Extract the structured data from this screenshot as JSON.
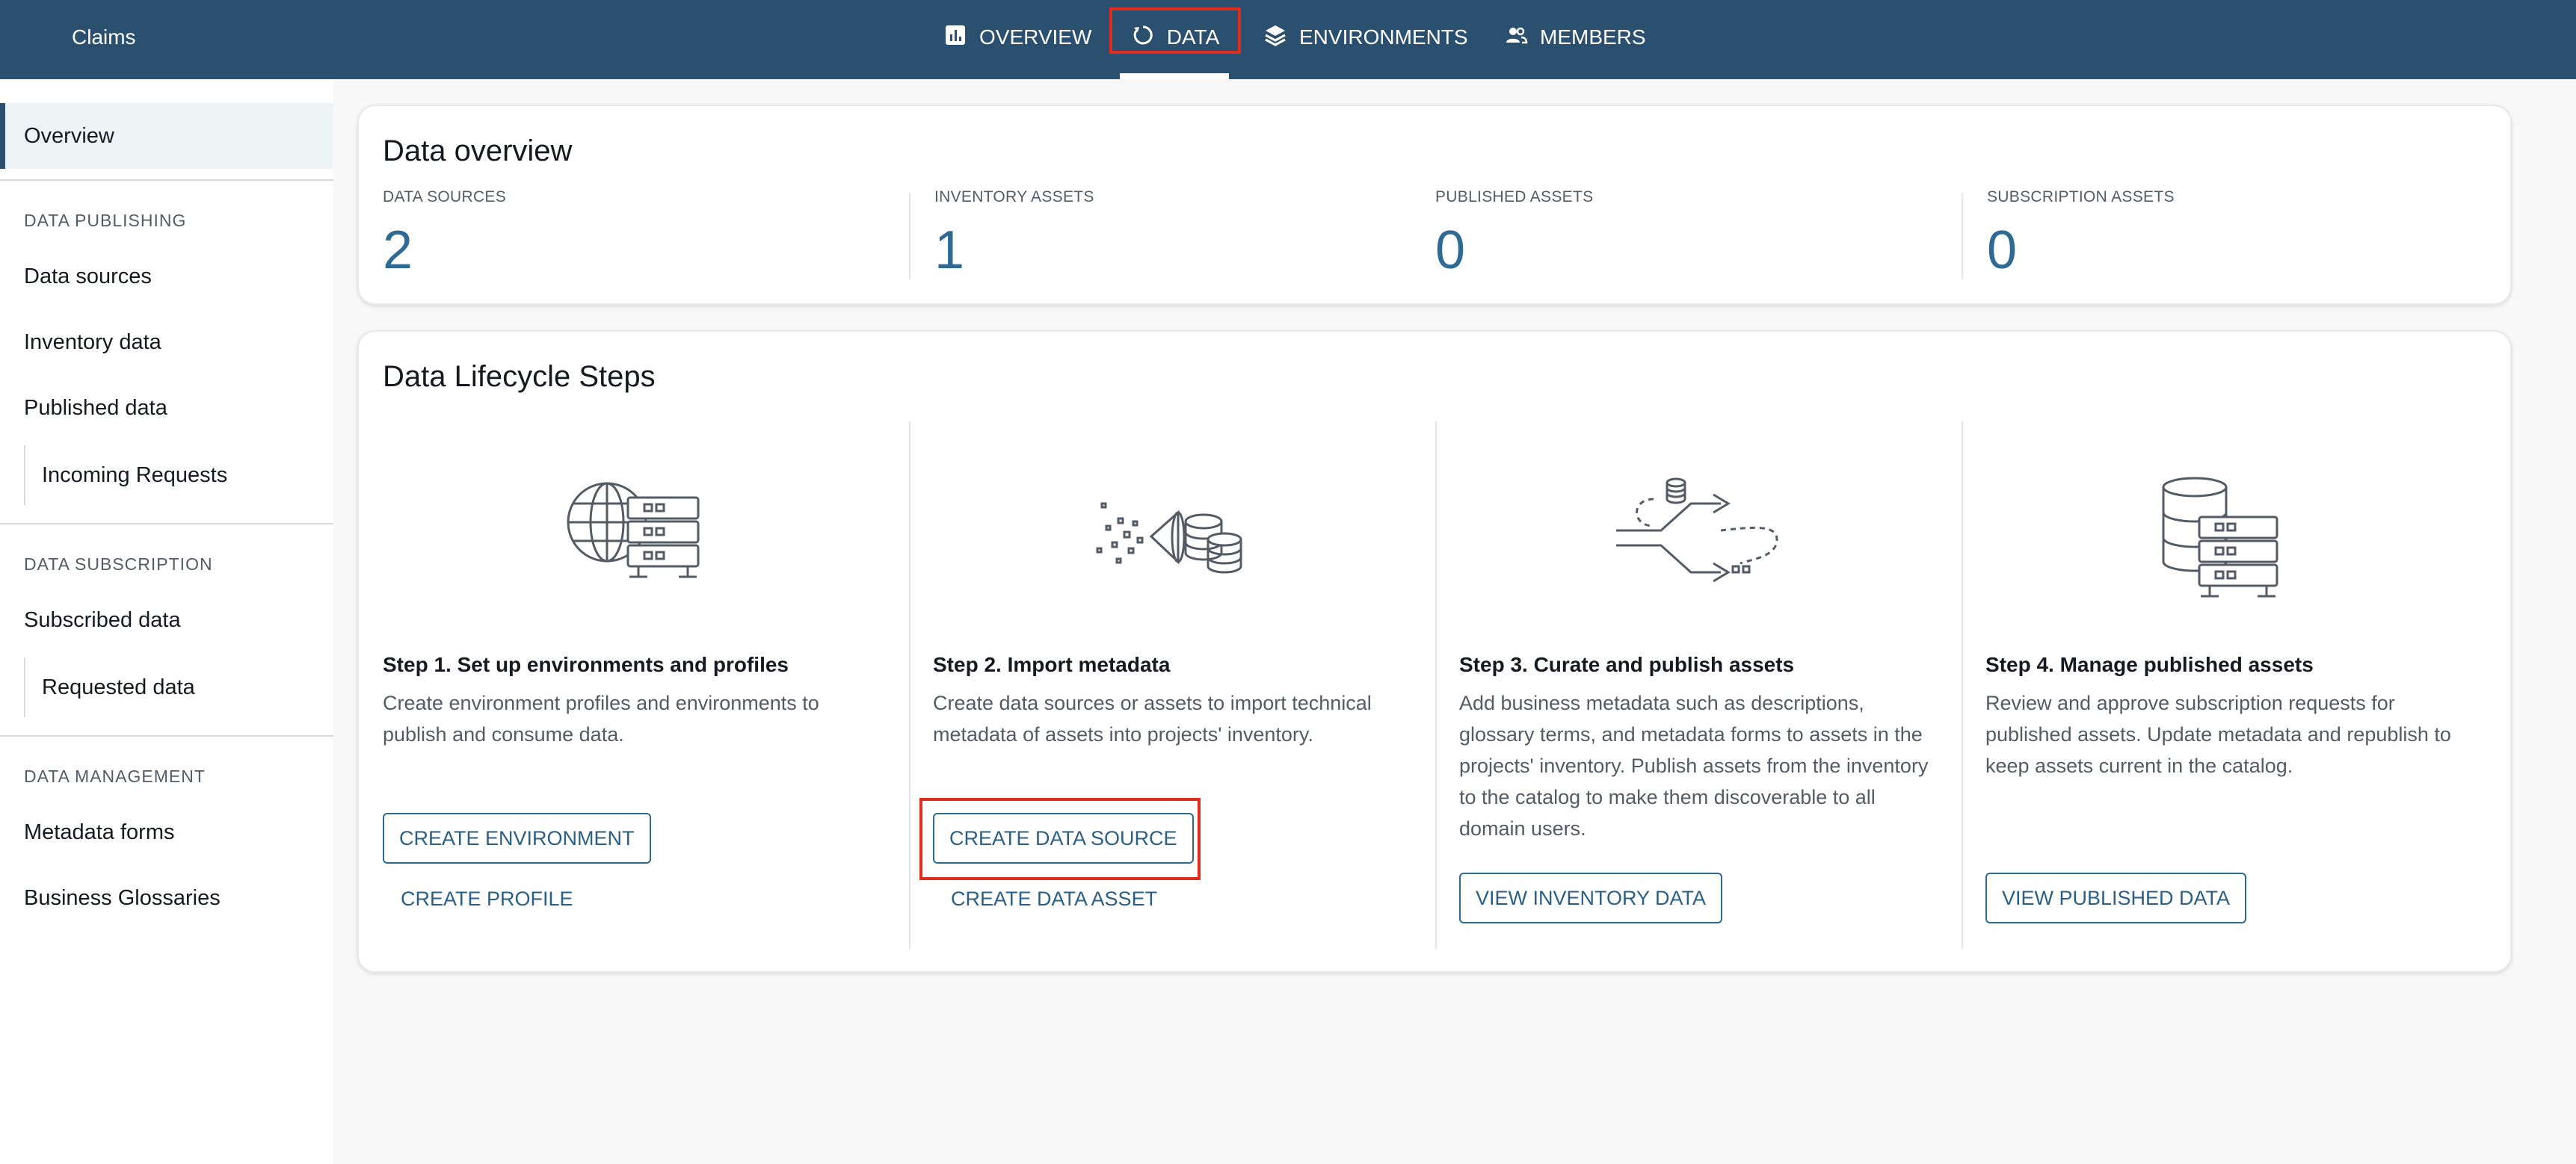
{
  "header": {
    "project_name": "Claims",
    "tabs": [
      {
        "label": "OVERVIEW",
        "icon": "bar-chart-icon"
      },
      {
        "label": "DATA",
        "icon": "circle-arrow-icon"
      },
      {
        "label": "ENVIRONMENTS",
        "icon": "layers-icon"
      },
      {
        "label": "MEMBERS",
        "icon": "people-icon"
      }
    ],
    "active_tab": "DATA"
  },
  "sidebar": {
    "overview": "Overview",
    "sections": [
      {
        "title": "DATA PUBLISHING",
        "items": [
          "Data sources",
          "Inventory data",
          "Published data"
        ],
        "sub_items": [
          "Incoming Requests"
        ]
      },
      {
        "title": "DATA SUBSCRIPTION",
        "items": [
          "Subscribed data"
        ],
        "sub_items": [
          "Requested data"
        ]
      },
      {
        "title": "DATA MANAGEMENT",
        "items": [
          "Metadata forms",
          "Business Glossaries"
        ]
      }
    ]
  },
  "data_overview": {
    "title": "Data overview",
    "metrics": [
      {
        "label": "DATA SOURCES",
        "value": "2"
      },
      {
        "label": "INVENTORY ASSETS",
        "value": "1"
      },
      {
        "label": "PUBLISHED ASSETS",
        "value": "0"
      },
      {
        "label": "SUBSCRIPTION ASSETS",
        "value": "0"
      }
    ]
  },
  "lifecycle": {
    "title": "Data Lifecycle Steps",
    "steps": [
      {
        "title": "Step 1. Set up environments and profiles",
        "description": "Create environment profiles and environments to publish and consume data.",
        "primary_button": "CREATE ENVIRONMENT",
        "secondary_link": "CREATE PROFILE",
        "icon": "globe-server-icon"
      },
      {
        "title": "Step 2. Import metadata",
        "description": "Create data sources or assets to import technical metadata of assets into projects' inventory.",
        "primary_button": "CREATE DATA SOURCE",
        "secondary_link": "CREATE DATA ASSET",
        "icon": "import-database-icon"
      },
      {
        "title": "Step 3. Curate and publish assets",
        "description": "Add business metadata such as descriptions, glossary terms, and metadata forms to assets in the projects' inventory. Publish assets from the inventory to the catalog to make them discoverable to all domain users.",
        "primary_button": "VIEW INVENTORY DATA",
        "icon": "curate-flow-icon"
      },
      {
        "title": "Step 4. Manage published assets",
        "description": "Review and approve subscription requests for published assets. Update metadata and republish to keep assets current in the catalog.",
        "primary_button": "VIEW PUBLISHED DATA",
        "icon": "database-server-icon"
      }
    ]
  },
  "colors": {
    "header_bg": "#2b4f6e",
    "accent_blue": "#2f6a93",
    "highlight_red": "#e02d1c"
  }
}
